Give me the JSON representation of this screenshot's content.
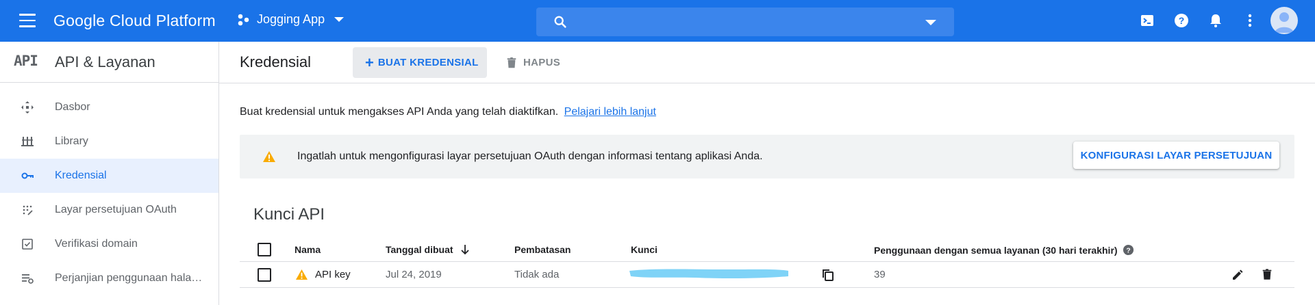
{
  "topbar": {
    "brand": "Google Cloud Platform",
    "project_name": "Jogging App",
    "search_placeholder": "",
    "icons": [
      "cloud-shell-icon",
      "help-icon",
      "notifications-icon",
      "more-vert-icon",
      "account-avatar"
    ]
  },
  "sidebar": {
    "logo": "API",
    "title": "API & Layanan",
    "items": [
      {
        "label": "Dasbor",
        "icon": "dashboard-icon"
      },
      {
        "label": "Library",
        "icon": "library-icon"
      },
      {
        "label": "Kredensial",
        "icon": "key-icon",
        "active": true
      },
      {
        "label": "Layar persetujuan OAuth",
        "icon": "oauth-consent-icon"
      },
      {
        "label": "Verifikasi domain",
        "icon": "domain-verify-icon"
      },
      {
        "label": "Perjanjian penggunaan hala…",
        "icon": "page-usage-icon"
      }
    ]
  },
  "header": {
    "title": "Kredensial",
    "create_label": "BUAT KREDENSIAL",
    "delete_label": "HAPUS"
  },
  "intro": {
    "text": "Buat kredensial untuk mengakses API Anda yang telah diaktifkan.",
    "link": "Pelajari lebih lanjut"
  },
  "banner": {
    "message": "Ingatlah untuk mengonfigurasi layar persetujuan OAuth dengan informasi tentang aplikasi Anda.",
    "button": "KONFIGURASI LAYAR PERSETUJUAN"
  },
  "api_keys": {
    "section_title": "Kunci API",
    "columns": [
      "Nama",
      "Tanggal dibuat",
      "Pembatasan",
      "Kunci",
      "Penggunaan dengan semua layanan (30 hari terakhir)"
    ],
    "rows": [
      {
        "name": "API key",
        "created": "Jul 24, 2019",
        "restriction": "Tidak ada",
        "key": "",
        "usage": "39"
      }
    ]
  },
  "colors": {
    "topbar": "#1a73e8",
    "accent": "#1a73e8",
    "warning": "#f9ab00",
    "redaction": "#7fd3f7"
  }
}
